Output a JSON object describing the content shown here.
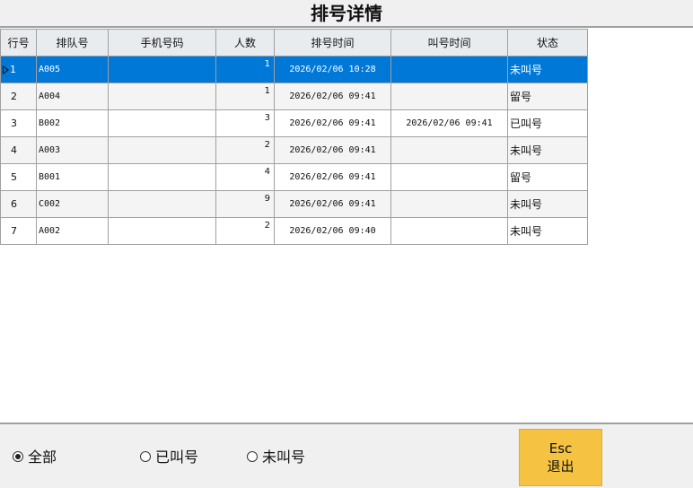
{
  "window": {
    "title": "排号详情"
  },
  "table": {
    "headers": [
      "行号",
      "排队号",
      "手机号码",
      "人数",
      "排号时间",
      "叫号时间",
      "状态"
    ],
    "rows": [
      {
        "row": "1",
        "queue_no": "A005",
        "phone": "",
        "people": "1",
        "queue_time": "2026/02/06 10:28",
        "call_time": "",
        "status": "未叫号",
        "selected": true
      },
      {
        "row": "2",
        "queue_no": "A004",
        "phone": "",
        "people": "1",
        "queue_time": "2026/02/06 09:41",
        "call_time": "",
        "status": "留号"
      },
      {
        "row": "3",
        "queue_no": "B002",
        "phone": "",
        "people": "3",
        "queue_time": "2026/02/06 09:41",
        "call_time": "2026/02/06 09:41",
        "status": "已叫号"
      },
      {
        "row": "4",
        "queue_no": "A003",
        "phone": "",
        "people": "2",
        "queue_time": "2026/02/06 09:41",
        "call_time": "",
        "status": "未叫号"
      },
      {
        "row": "5",
        "queue_no": "B001",
        "phone": "",
        "people": "4",
        "queue_time": "2026/02/06 09:41",
        "call_time": "",
        "status": "留号"
      },
      {
        "row": "6",
        "queue_no": "C002",
        "phone": "",
        "people": "9",
        "queue_time": "2026/02/06 09:41",
        "call_time": "",
        "status": "未叫号"
      },
      {
        "row": "7",
        "queue_no": "A002",
        "phone": "",
        "people": "2",
        "queue_time": "2026/02/06 09:40",
        "call_time": "",
        "status": "未叫号"
      }
    ]
  },
  "filters": {
    "all": "全部",
    "called": "已叫号",
    "not_called": "未叫号",
    "selected": "all"
  },
  "esc_button": {
    "key": "Esc",
    "label": "退出"
  },
  "colors": {
    "selection": "#0078d7",
    "exit_button": "#f5c242",
    "panel": "#f0f0f0"
  }
}
